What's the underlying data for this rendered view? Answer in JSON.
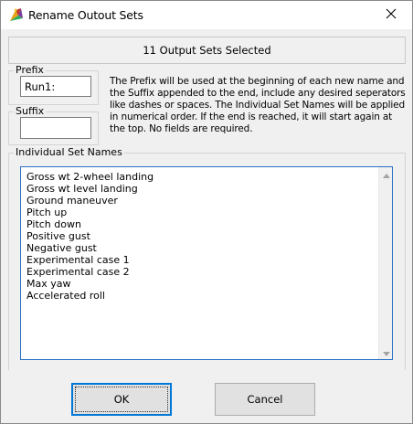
{
  "window": {
    "title": "Rename Outout Sets",
    "close_icon": "close-icon",
    "app_icon": "app-logo-icon"
  },
  "header": {
    "selected_text": "11 Output Sets Selected"
  },
  "prefix": {
    "label": "Prefix",
    "value": "Run1:"
  },
  "suffix": {
    "label": "Suffix",
    "value": ""
  },
  "description": "The Prefix will be used at the beginning of each new name and the Suffix appended to the end, include any desired seperators like dashes or spaces. The Individual Set Names will be applied in numerical order. If the end is reached, it will start again at the top. No fields are required.",
  "set_names": {
    "label": "Individual Set Names",
    "items": [
      "Gross wt 2-wheel landing",
      "Gross wt level landing",
      "Ground maneuver",
      "Pitch up",
      "Pitch down",
      "Positive gust",
      "Negative gust",
      "Experimental case 1",
      "Experimental case 2",
      "Max yaw",
      "Accelerated roll"
    ]
  },
  "buttons": {
    "ok_label": "OK",
    "cancel_label": "Cancel"
  },
  "colors": {
    "accent": "#0078d7",
    "list_border": "#2a6fc4"
  }
}
